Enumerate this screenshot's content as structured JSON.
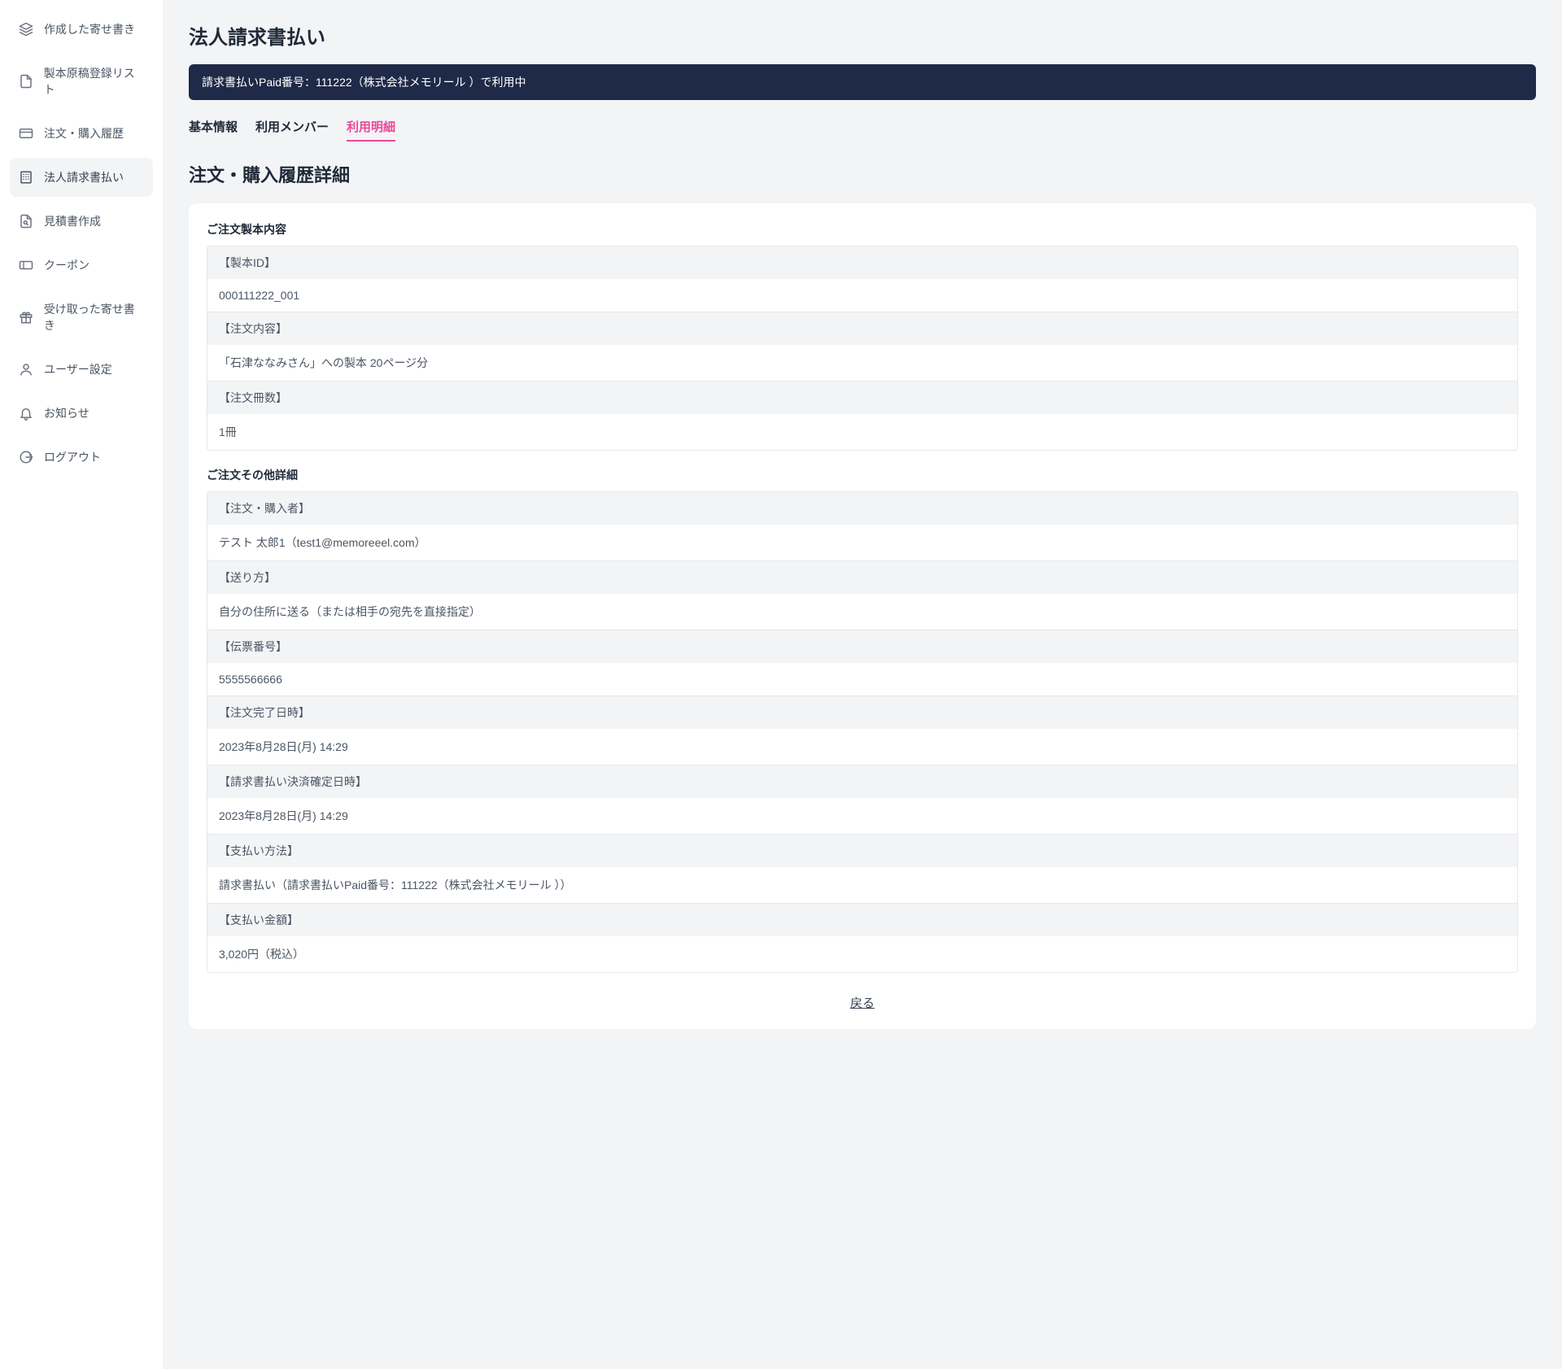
{
  "sidebar": {
    "items": [
      {
        "label": "作成した寄せ書き"
      },
      {
        "label": "製本原稿登録リスト"
      },
      {
        "label": "注文・購入履歴"
      },
      {
        "label": "法人請求書払い"
      },
      {
        "label": "見積書作成"
      },
      {
        "label": "クーポン"
      },
      {
        "label": "受け取った寄せ書き"
      },
      {
        "label": "ユーザー設定"
      },
      {
        "label": "お知らせ"
      },
      {
        "label": "ログアウト"
      }
    ]
  },
  "page": {
    "title": "法人請求書払い",
    "banner": "請求書払いPaid番号：111222（株式会社メモリール ）で利用中",
    "tabs": [
      {
        "label": "基本情報"
      },
      {
        "label": "利用メンバー"
      },
      {
        "label": "利用明細"
      }
    ],
    "section_title": "注文・購入履歴詳細"
  },
  "order_content": {
    "heading": "ご注文製本内容",
    "rows": [
      {
        "label": "【製本ID】",
        "value": "000111222_001"
      },
      {
        "label": "【注文内容】",
        "value": "「石津ななみさん」への製本 20ページ分"
      },
      {
        "label": "【注文冊数】",
        "value": "1冊"
      }
    ]
  },
  "order_detail": {
    "heading": "ご注文その他詳細",
    "rows": [
      {
        "label": "【注文・購入者】",
        "value": "テスト 太郎1（test1@memoreeel.com）"
      },
      {
        "label": "【送り方】",
        "value": "自分の住所に送る（または相手の宛先を直接指定）"
      },
      {
        "label": "【伝票番号】",
        "value": "5555566666"
      },
      {
        "label": "【注文完了日時】",
        "value": "2023年8月28日(月) 14:29"
      },
      {
        "label": "【請求書払い決済確定日時】",
        "value": "2023年8月28日(月) 14:29"
      },
      {
        "label": "【支払い方法】",
        "value": "請求書払い（請求書払いPaid番号：111222（株式会社メモリール ））"
      },
      {
        "label": "【支払い金額】",
        "value": "3,020円（税込）"
      }
    ]
  },
  "back_label": "戻る"
}
